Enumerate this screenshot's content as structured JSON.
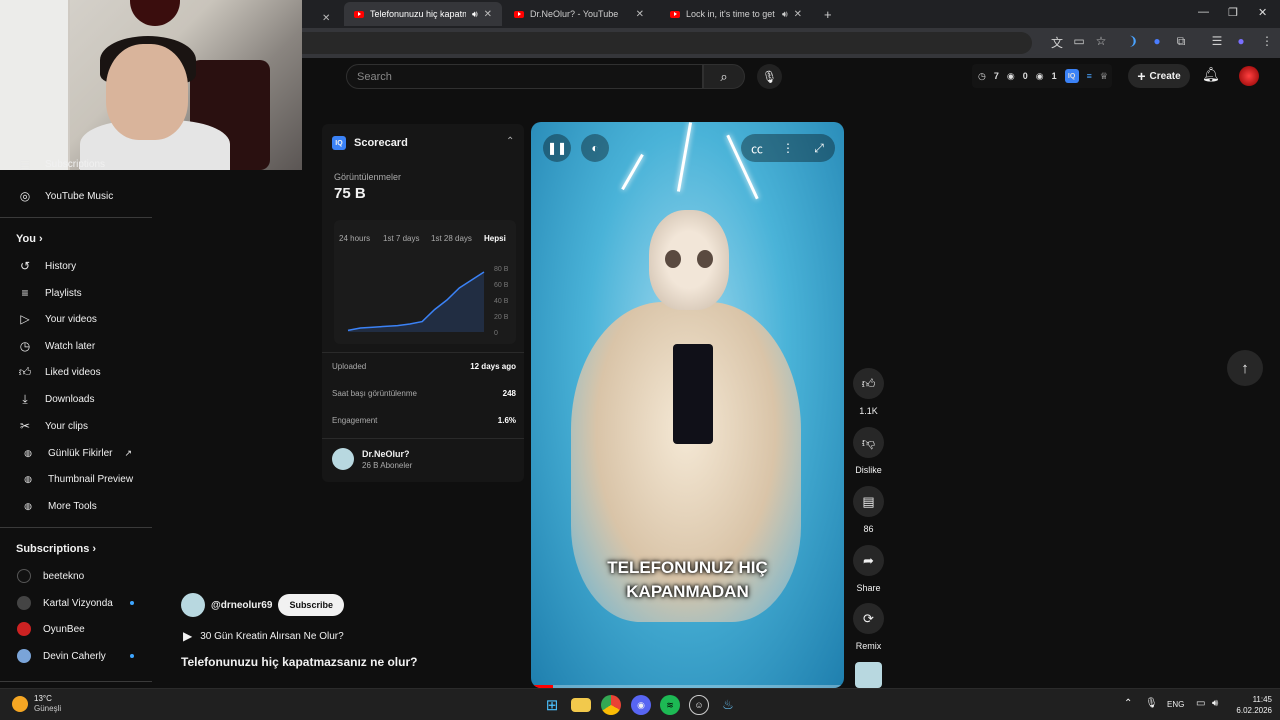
{
  "browser": {
    "tabs": [
      {
        "label": "Telefonunuzu hiç kapatmaz",
        "active": true,
        "audio": true
      },
      {
        "label": "Dr.NeOlur? - YouTube",
        "active": false,
        "audio": false
      },
      {
        "label": "Lock in, it's time to get sh*t",
        "active": false,
        "audio": true
      }
    ],
    "new_tab": "+"
  },
  "header": {
    "search_placeholder": "Search",
    "stat_a": "7",
    "stat_b": "0",
    "stat_c": "1",
    "create_label": "Create"
  },
  "sidebar": {
    "top_item": "Subscriptions",
    "music": "YouTube Music",
    "you_heading": "You",
    "you_items": [
      "History",
      "Playlists",
      "Your videos",
      "Watch later",
      "Liked videos",
      "Downloads",
      "Your clips",
      "Günlük Fikirler",
      "Thumbnail Preview",
      "More Tools"
    ],
    "subs_heading": "Subscriptions",
    "subs": [
      "beetekno",
      "Kartal Vizyonda",
      "OyunBee",
      "Devin Caherly"
    ]
  },
  "scorecard": {
    "title": "Scorecard",
    "logo": "IQ",
    "metric_label": "Görüntülenmeler",
    "metric_value": "75 B",
    "tabs": [
      "24 hours",
      "1st 7 days",
      "1st 28 days",
      "Hepsi"
    ],
    "selected_tab": "Hepsi",
    "yticks": [
      "80 B",
      "60 B",
      "40 B",
      "20 B",
      "0"
    ],
    "rows": [
      {
        "label": "Uploaded",
        "value": "12 days ago"
      },
      {
        "label": "Saat başı görüntülenme",
        "value": "248"
      },
      {
        "label": "Engagement",
        "value": "1.6%"
      }
    ],
    "channel_name": "Dr.NeOlur?",
    "channel_subs": "26 B Aboneler"
  },
  "chart_data": {
    "type": "area",
    "x": [
      1,
      2,
      3,
      4,
      5,
      6,
      7,
      8,
      9,
      10,
      11,
      12
    ],
    "values": [
      2,
      5,
      6,
      7,
      8,
      10,
      13,
      28,
      40,
      55,
      65,
      75
    ],
    "ylim": [
      0,
      80
    ],
    "yticks": [
      "80 B",
      "60 B",
      "40 B",
      "20 B",
      "0"
    ],
    "color": "#3b82f6"
  },
  "video": {
    "caption_line1": "TELEFONUNUZ HIÇ",
    "caption_line2": "KAPANMADAN",
    "progress": 0.07
  },
  "actions": {
    "like_count": "1.1K",
    "dislike_label": "Dislike",
    "comment_count": "86",
    "share_label": "Share",
    "remix_label": "Remix"
  },
  "below": {
    "channel_handle": "@drneolur69",
    "subscribe_label": "Subscribe",
    "playlist_label": "30 Gün Kreatin Alırsan Ne Olur?",
    "title": "Telefonunuzu hiç kapatmazsanız ne olur?"
  },
  "taskbar": {
    "weather_temp": "13°C",
    "weather_desc": "Güneşli",
    "lang": "ENG",
    "time": "11:45",
    "date": "6.02.2026"
  },
  "colors": {
    "accent": "#3ea6ff",
    "brand_red": "#ff0000",
    "chart_blue": "#3b82f6"
  }
}
